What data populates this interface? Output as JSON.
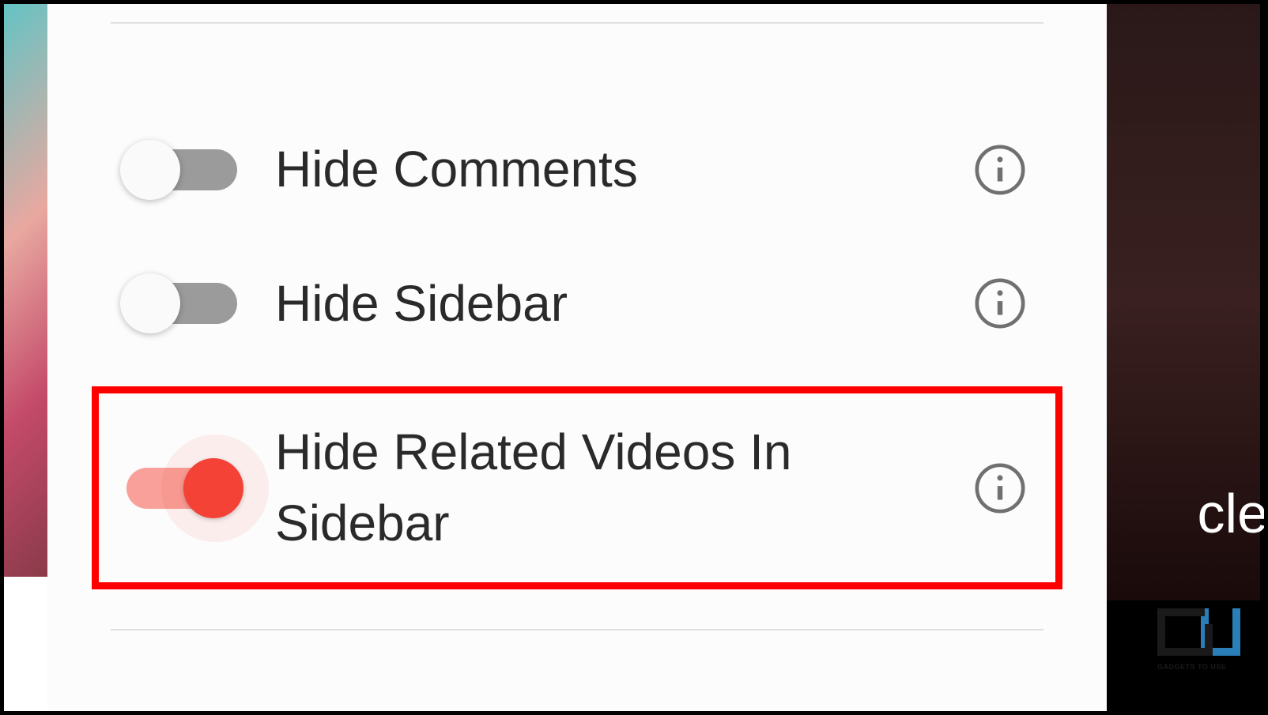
{
  "settings": {
    "items": [
      {
        "id": "hide-comments",
        "label": "Hide Comments",
        "enabled": false,
        "highlighted": false
      },
      {
        "id": "hide-sidebar",
        "label": "Hide Sidebar",
        "enabled": false,
        "highlighted": false
      },
      {
        "id": "hide-related-videos",
        "label": "Hide Related Videos In Sidebar",
        "enabled": true,
        "highlighted": true
      }
    ]
  },
  "colors": {
    "toggle_off_track": "#9b9b9b",
    "toggle_on_track": "rgba(244,67,54,0.5)",
    "toggle_on_thumb": "#f44336",
    "highlight_border": "#ff0000",
    "icon_stroke": "#707070"
  },
  "background": {
    "partial_text": "cle"
  },
  "watermark": {
    "text": "GADGETS TO USE"
  }
}
